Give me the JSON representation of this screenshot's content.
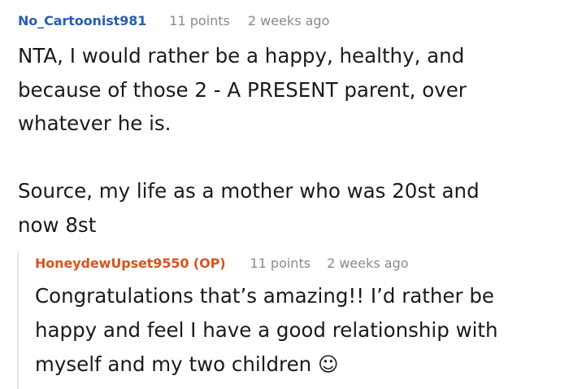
{
  "comment": {
    "author": "No_Cartoonist981",
    "author_color": "#2a5db0",
    "points": "11 points",
    "time": "2 weeks ago",
    "body": "NTA, I would rather be a happy, healthy, and\nbecause of those 2 - A PRESENT parent, over\nwhatever he is.\n\nSource, my life as a mother who was 20st and\nnow 8st"
  },
  "reply": {
    "author": "HoneydewUpset9550 (OP)",
    "author_color": "#d9531e",
    "points": "11 points",
    "time": "2 weeks ago",
    "body": "Congratulations that’s amazing!! I’d rather be\nhappy and feel I have a good relationship with\nmyself and my two children ☺"
  }
}
